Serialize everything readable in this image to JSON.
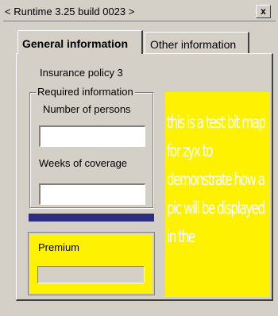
{
  "window": {
    "title": "< Runtime 3.25 build 0023 >",
    "close_label": "x"
  },
  "tabs": [
    {
      "label": "General information",
      "active": true
    },
    {
      "label": "Other information",
      "active": false
    }
  ],
  "form": {
    "policy_label": "Insurance policy 3",
    "group_title": "Required information",
    "persons_label": "Number of persons",
    "persons_value": "",
    "weeks_label": "Weeks of coverage",
    "weeks_value": "",
    "premium_label": "Premium",
    "premium_value": ""
  },
  "picture": {
    "text": "this is a test bit map for zyx to demonstrate how a pic will be displayed in the"
  },
  "colors": {
    "background": "#d4d0c8",
    "highlight_yellow": "#fff200",
    "divider_navy": "#2e2e80"
  }
}
